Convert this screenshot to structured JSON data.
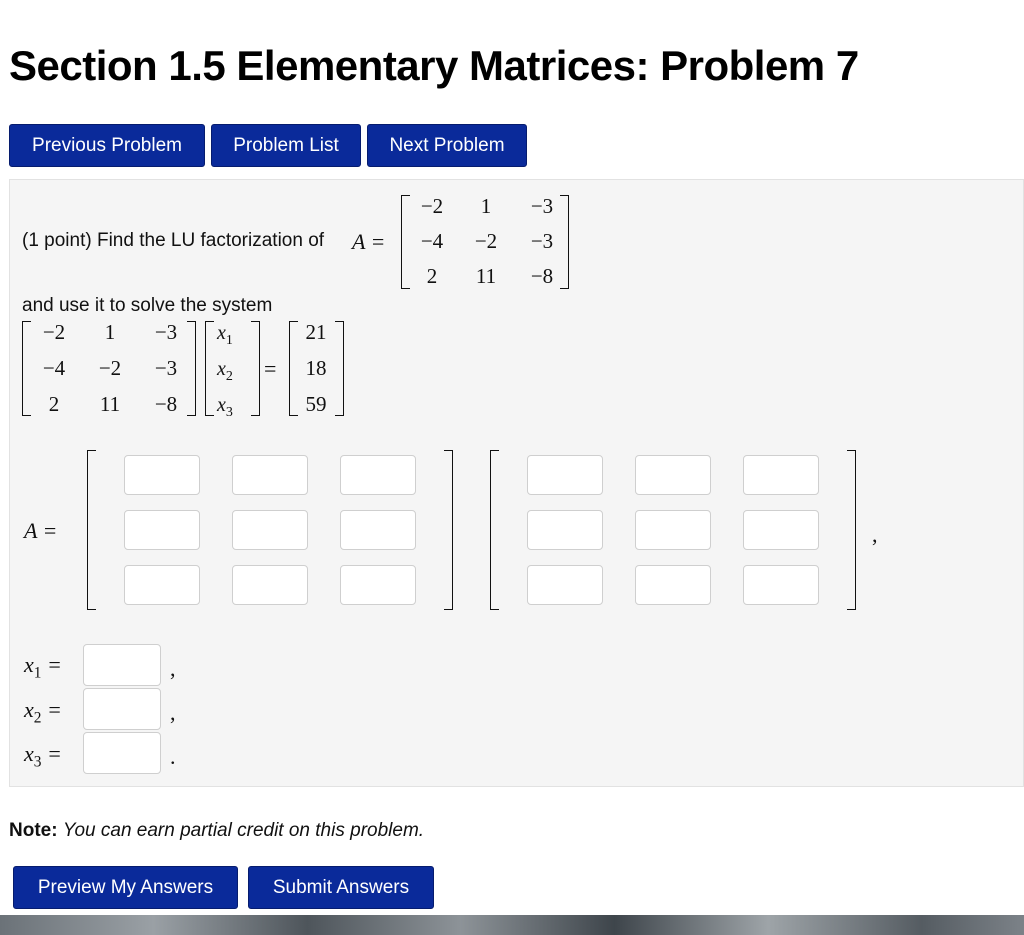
{
  "page_title": "Section 1.5 Elementary Matrices: Problem 7",
  "nav": {
    "previous": "Previous Problem",
    "list": "Problem List",
    "next": "Next Problem"
  },
  "problem": {
    "intro": "(1 point) Find the LU factorization of",
    "a_label": "A =",
    "matrix_A": [
      [
        "−2",
        "1",
        "−3"
      ],
      [
        "−4",
        "−2",
        "−3"
      ],
      [
        "2",
        "11",
        "−8"
      ]
    ],
    "solve_text": "and use it to solve the system",
    "system_vars": [
      "x1",
      "x2",
      "x3"
    ],
    "equals": "=",
    "rhs": [
      "21",
      "18",
      "59"
    ],
    "answer_label": "A =",
    "trailing_comma": ",",
    "x_labels": [
      "x1 =",
      "x2 =",
      "x3 ="
    ],
    "x_punct": [
      ",",
      ",",
      "."
    ]
  },
  "note": {
    "bold": "Note:",
    "italic": "You can earn partial credit on this problem."
  },
  "actions": {
    "preview": "Preview My Answers",
    "submit": "Submit Answers"
  },
  "colors": {
    "button_bg": "#0a2a9a",
    "panel_bg": "#f5f5f5"
  }
}
